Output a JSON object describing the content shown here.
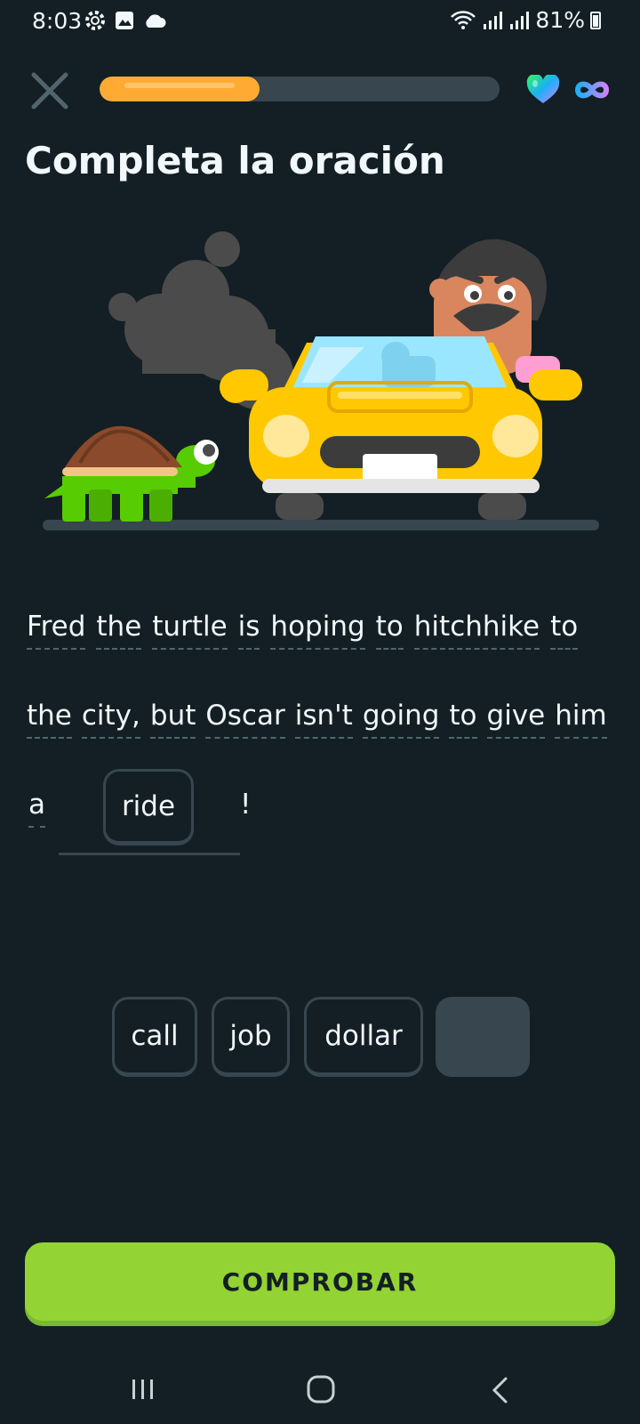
{
  "status_bar": {
    "time": "8:03",
    "battery": "81%",
    "icons": [
      "settings-gear-icon",
      "gallery-icon",
      "cloud-icon",
      "wifi-icon",
      "signal-icon",
      "signal-icon",
      "battery-icon"
    ]
  },
  "header": {
    "progress": 0.4,
    "icons": [
      "close-icon",
      "heart-icon",
      "infinity-icon"
    ]
  },
  "title": "Completa la oración",
  "sentence": {
    "line1": [
      "Fred",
      "the",
      "turtle",
      "is",
      "hoping",
      "to",
      "hitchhike",
      "to"
    ],
    "line2": [
      "the",
      "city,",
      "but",
      "Oscar",
      "isn't",
      "going",
      "to",
      "give",
      "him"
    ],
    "line3_prefix": "a",
    "blank_answer": "ride",
    "line3_suffix": "!"
  },
  "word_bank": [
    "call",
    "job",
    "dollar",
    ""
  ],
  "check_button": "COMPROBAR",
  "colors": {
    "background": "#131f24",
    "progress": "#ffab33",
    "button": "#93d333",
    "chip_border": "#37464f"
  }
}
